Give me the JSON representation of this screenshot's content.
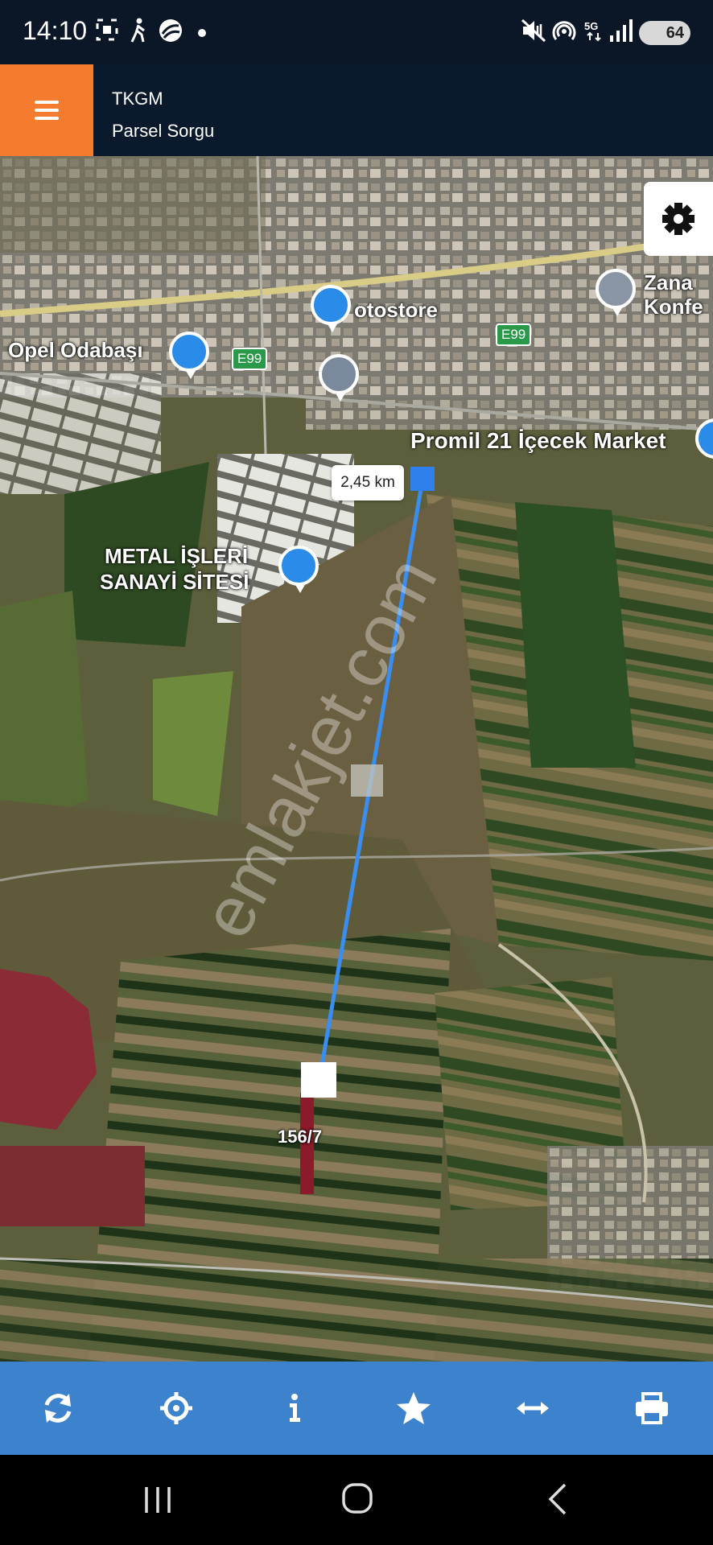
{
  "status_bar": {
    "time": "14:10",
    "battery": "64",
    "icons": [
      "screenshot-icon",
      "accessibility-icon",
      "app-icon",
      "dot-icon",
      "mute-icon",
      "hotspot-icon",
      "5g-icon",
      "signal-icon",
      "battery-icon"
    ]
  },
  "header": {
    "title": "TKGM",
    "subtitle": "Parsel Sorgu",
    "menu_icon": "hamburger-menu-icon"
  },
  "map": {
    "settings_icon": "gear-icon",
    "distance": "2,45 km",
    "parcel": "156/7",
    "labels": {
      "opel": "Opel Odabaşı",
      "otostore": "otostore",
      "zana": "Zana",
      "konfe": "Konfe",
      "promil": "Promil 21 İçecek Market",
      "metal1": "METAL İŞLERİ",
      "metal2": "SANAYİ SİTESİ",
      "road1": "E99",
      "road2": "E99"
    },
    "watermark": "emlakjet.com"
  },
  "toolbar": {
    "items": [
      "refresh-icon",
      "locate-icon",
      "info-icon",
      "star-icon",
      "measure-icon",
      "print-icon"
    ]
  },
  "nav": {
    "items": [
      "recents-icon",
      "home-icon",
      "back-icon"
    ]
  },
  "colors": {
    "accent": "#f57b2e",
    "header": "#0a1a2c",
    "toolbar": "#3d82cc",
    "route": "#3a8ef0",
    "parcel": "#8b1a2a"
  }
}
